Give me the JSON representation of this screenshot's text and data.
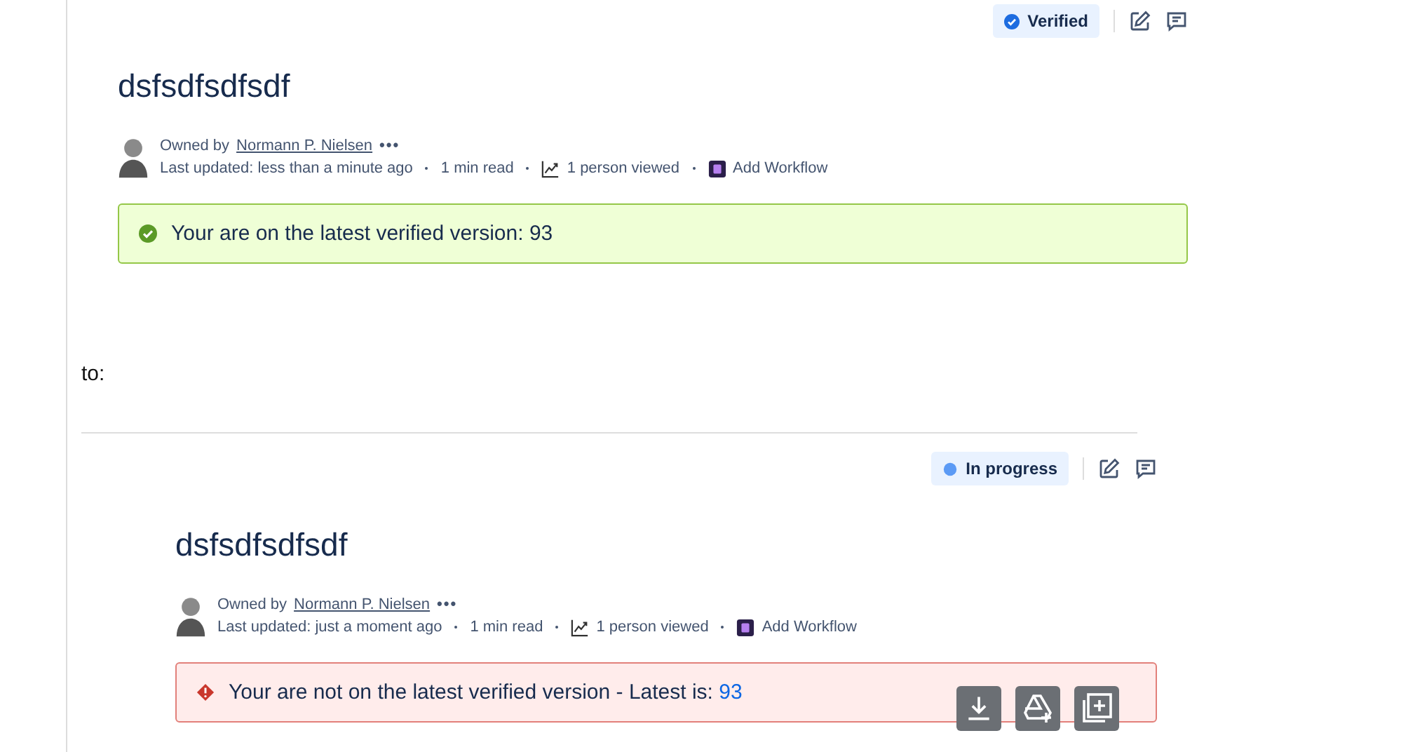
{
  "versions": [
    {
      "status": {
        "kind": "verified",
        "label": "Verified"
      },
      "title": "dsfsdfsdfsdf",
      "owner_prefix": "Owned by",
      "owner": "Normann P. Nielsen",
      "more": "•••",
      "updated": "Last updated: less than a minute ago",
      "read_time": "1 min read",
      "views": "1 person viewed",
      "workflow": "Add Workflow",
      "banner": {
        "kind": "success",
        "text": "Your are on the latest verified version: ",
        "version": "93"
      }
    },
    {
      "status": {
        "kind": "in_progress",
        "label": "In progress"
      },
      "title": "dsfsdfsdfsdf",
      "owner_prefix": "Owned by",
      "owner": "Normann P. Nielsen",
      "more": "•••",
      "updated": "Last updated: just a moment ago",
      "read_time": "1 min read",
      "views": "1 person viewed",
      "workflow": "Add Workflow",
      "banner": {
        "kind": "error",
        "text": "Your are not on the latest verified version - Latest is: ",
        "version": "93"
      }
    }
  ],
  "separator_text": "to:",
  "floating_actions": [
    {
      "kind": "download"
    },
    {
      "kind": "drive"
    },
    {
      "kind": "library"
    }
  ]
}
